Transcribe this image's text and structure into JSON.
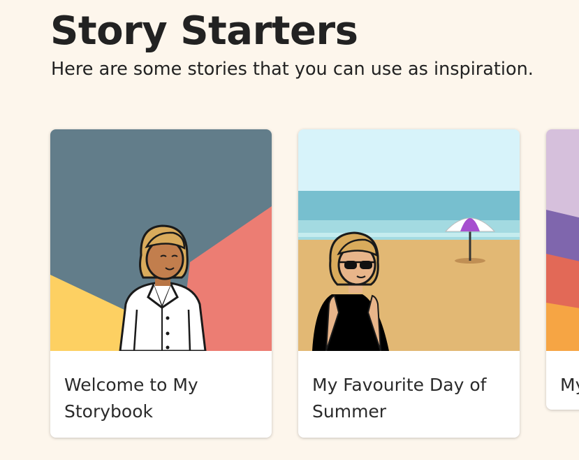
{
  "header": {
    "title": "Story Starters",
    "subtitle": "Here are some stories that you can use as inspiration."
  },
  "stories": [
    {
      "title": "Welcome to My Storybook",
      "image_icon": "storybook-illustration"
    },
    {
      "title": "My Favourite Day of Summer",
      "image_icon": "beach-illustration"
    },
    {
      "title": "My",
      "image_icon": "abstract-illustration"
    }
  ],
  "colors": {
    "background": "#fdf6ec",
    "card_background": "#ffffff",
    "text": "#222222"
  }
}
